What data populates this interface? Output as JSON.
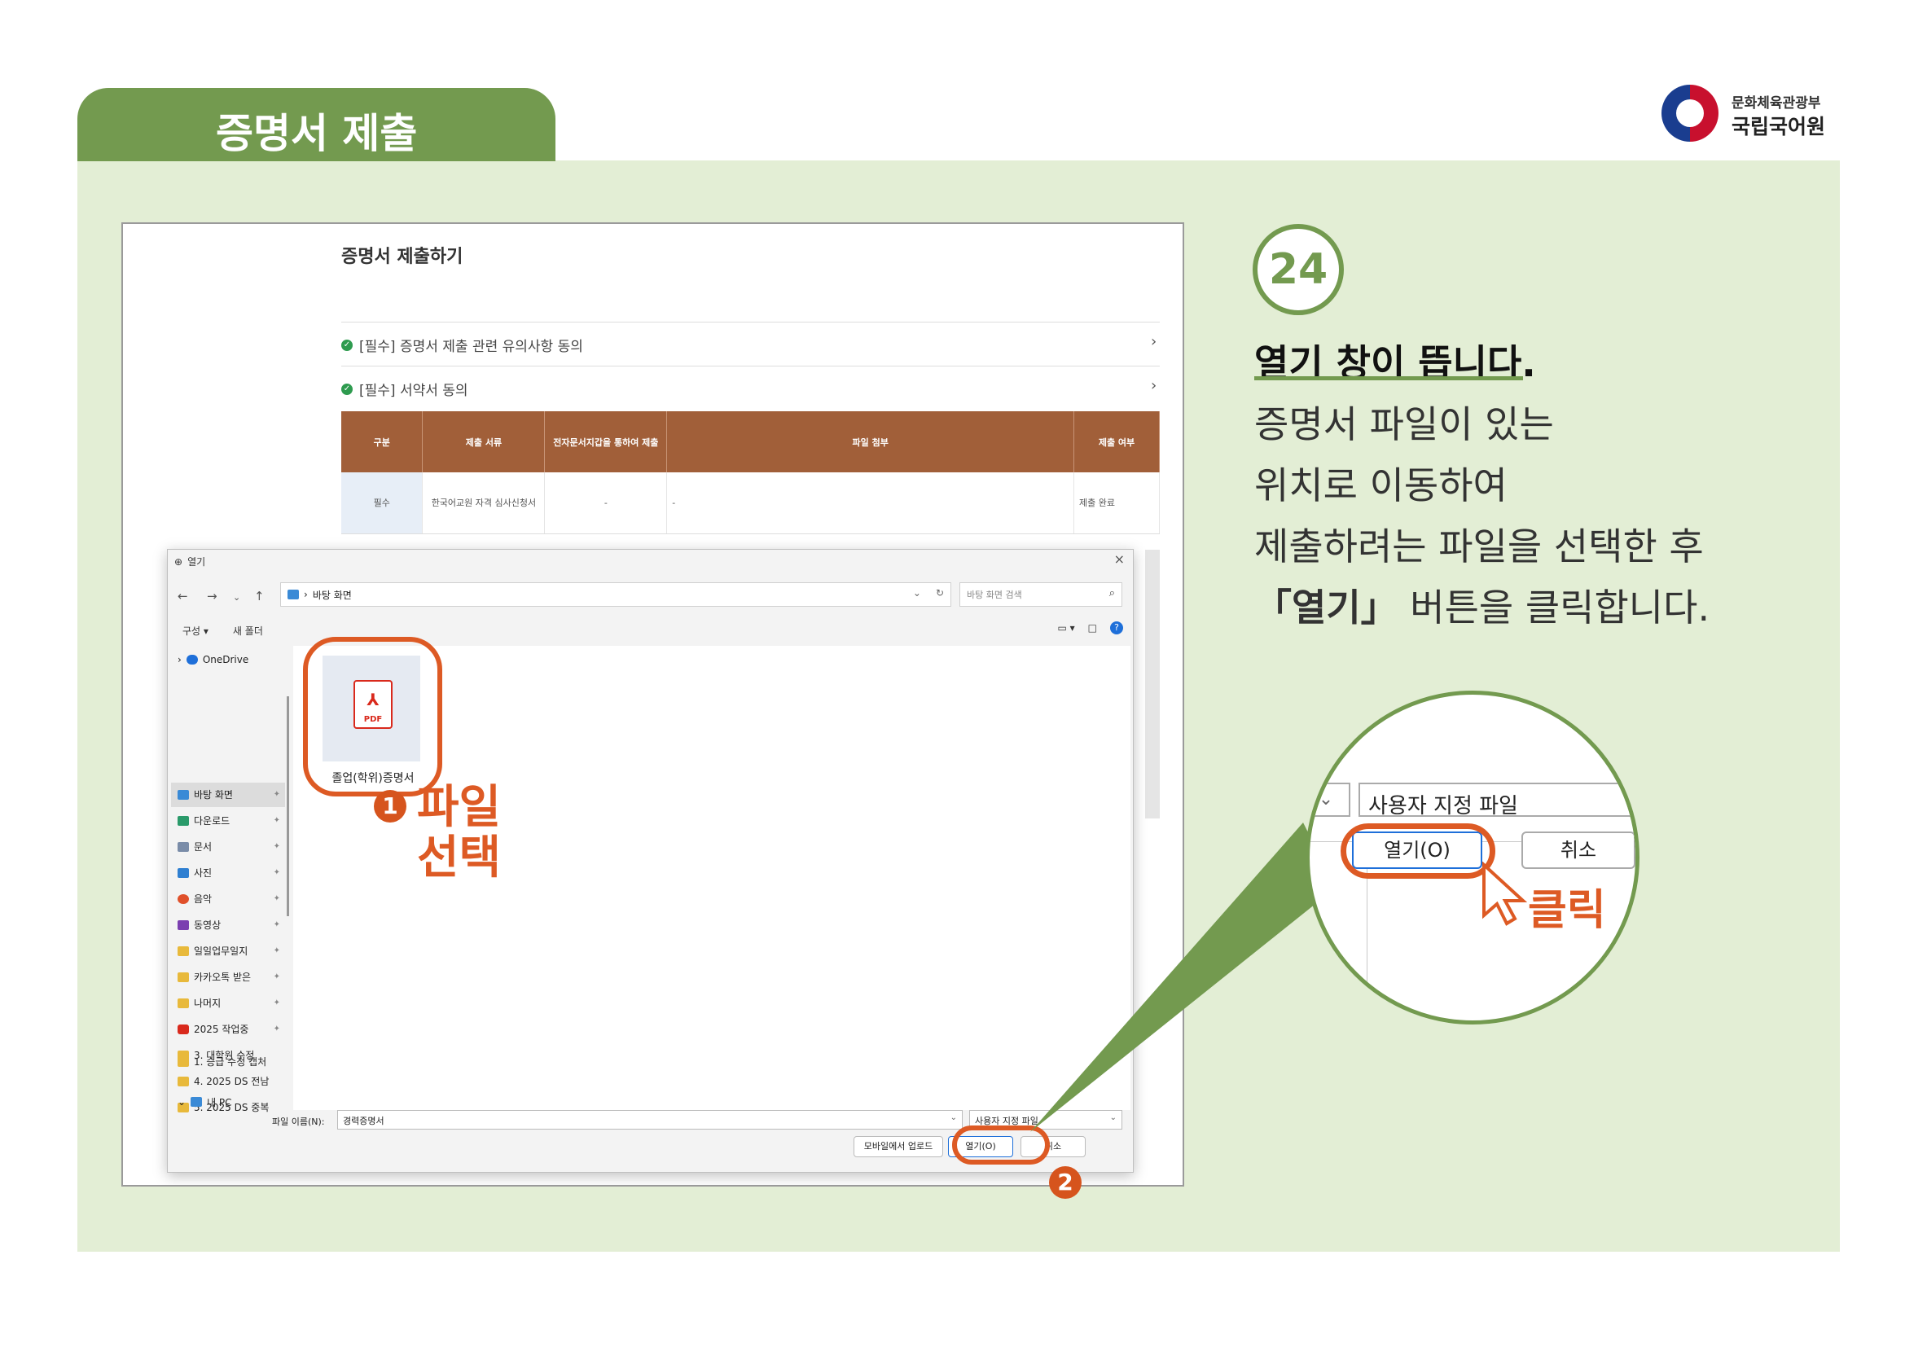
{
  "header": {
    "tab_title": "증명서 제출",
    "logo_sub": "문화체육관광부",
    "logo_main": "국립국어원"
  },
  "web": {
    "page_title": "증명서 제출하기",
    "agree_items": [
      "[필수] 증명서 제출 관련 유의사항 동의",
      "[필수] 서약서 동의"
    ],
    "table_headers": [
      "구분",
      "제출 서류",
      "전자문서지갑을 통하여 제출",
      "파일 첨부",
      "제출 여부"
    ],
    "table_rows": [
      [
        "필수",
        "한국어교원 자격 심사신청서",
        "-",
        "-",
        "제출 완료"
      ]
    ]
  },
  "dialog": {
    "title": "열기",
    "path": "바탕 화면",
    "search_placeholder": "바탕 화면 검색",
    "organize": "구성 ▾",
    "new_folder": "새 폴더",
    "onedrive": "OneDrive",
    "sidebar": [
      "바탕 화면",
      "다운로드",
      "문서",
      "사진",
      "음악",
      "동영상",
      "일일업무일지",
      "카카오톡 받은",
      "나머지",
      "2025 작업중",
      "3. 대학원 수정",
      "4. 2025 DS 전남",
      "5. 2025 DS 중복",
      "1. 승급 수정 캡처"
    ],
    "this_pc": "내 PC",
    "file_name": "졸업(학위)증명서",
    "filename_label": "파일 이름(N):",
    "filename_value": "경력증명서",
    "filetype": "사용자 지정 파일",
    "mobile_btn": "모바일에서 업로드",
    "open_btn": "열기(O)",
    "cancel_btn": "취소"
  },
  "annotations": {
    "step1": "1",
    "step1_text_line1": "파일",
    "step1_text_line2": "선택",
    "step2": "2",
    "click_text": "클릭"
  },
  "instructions": {
    "step_number": "24",
    "heading": "열기 창이 뜹니다.",
    "line1": "증명서 파일이 있는",
    "line2": "위치로 이동하여",
    "line3": "제출하려는 파일을 선택한 후",
    "line4_bold": "「열기」",
    "line4_rest": " 버튼을 클릭합니다."
  },
  "zoom": {
    "filetype": "사용자 지정 파일",
    "open_btn": "열기(O)",
    "cancel_btn": "취소"
  },
  "colors": {
    "green": "#739a4f",
    "light_green": "#e3eed5",
    "orange": "#dd5a24",
    "brown": "#a15f39"
  }
}
